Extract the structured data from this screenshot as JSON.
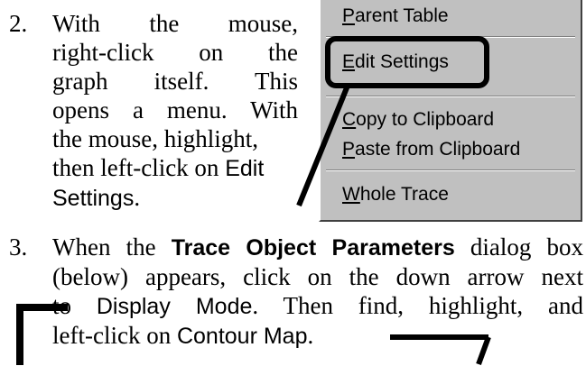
{
  "step2": {
    "number": "2.",
    "lines": [
      "With the mouse,",
      "right-click on the",
      "graph itself. This",
      "opens a menu. With",
      "the mouse, highlight,"
    ],
    "last_prefix": "then left-click on ",
    "edit": "Edit",
    "settings": "Settings",
    "period": "."
  },
  "menu": {
    "items": [
      {
        "mnemonic": "P",
        "rest": "arent Table"
      },
      {
        "mnemonic": "E",
        "rest": "dit Settings"
      },
      {
        "mnemonic": "C",
        "rest": "opy to Clipboard"
      },
      {
        "mnemonic": "P",
        "rest": "aste from Clipboard"
      },
      {
        "mnemonic": "W",
        "rest": "hole Trace"
      }
    ]
  },
  "step3": {
    "number": "3.",
    "p1": "When the ",
    "dialog_name": "Trace Object Parameters",
    "p2": " dialog box",
    "line2": "(below) appears, click on the down arrow next",
    "p3": "to ",
    "display_mode": "Display Mode",
    "p4": ". Then find, highlight, and",
    "p5": "left-click on ",
    "contour_map": "Contour Map",
    "p6": "."
  }
}
